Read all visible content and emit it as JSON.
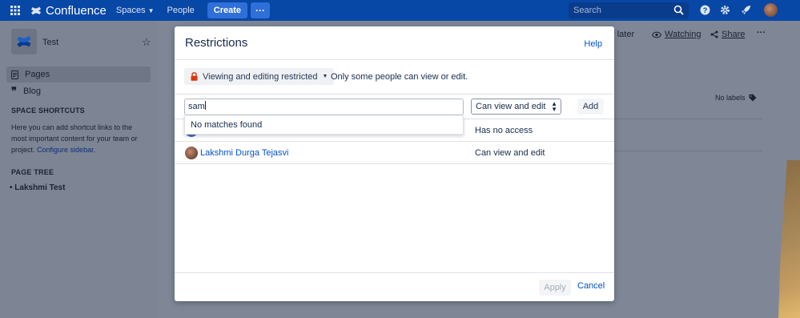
{
  "topnav": {
    "product": "Confluence",
    "spaces": "Spaces",
    "people": "People",
    "create": "Create",
    "more": "···",
    "search_placeholder": "Search"
  },
  "sidebar": {
    "space_name": "Test",
    "items": [
      {
        "label": "Pages",
        "icon": "pages-icon"
      },
      {
        "label": "Blog",
        "icon": "quote-icon"
      }
    ],
    "shortcuts_heading": "SPACE SHORTCUTS",
    "shortcuts_text": "Here you can add shortcut links to the most important content for your team or project.",
    "configure_link": "Configure sidebar",
    "page_tree_heading": "PAGE TREE",
    "tree_item": "Lakshmi Test"
  },
  "page": {
    "save_later": "r later",
    "watching": "Watching",
    "share": "Share",
    "more": "···",
    "no_labels": "No labels"
  },
  "modal": {
    "title": "Restrictions",
    "help": "Help",
    "restriction_button": "Viewing and editing restricted",
    "restriction_description": "Only some people can view or edit.",
    "user_input_value": "sam",
    "permission_selected": "Can view and edit",
    "add": "Add",
    "dropdown_message": "No matches found",
    "rows": [
      {
        "name": "",
        "permission": "Has no access"
      },
      {
        "name": "Lakshmi Durga Tejasvi",
        "permission": "Can view and edit"
      }
    ],
    "apply": "Apply",
    "cancel": "Cancel"
  },
  "colors": {
    "nav": "#0747a6",
    "link": "#0052cc",
    "lock": "#de350b",
    "overlay": "#7f8797"
  }
}
